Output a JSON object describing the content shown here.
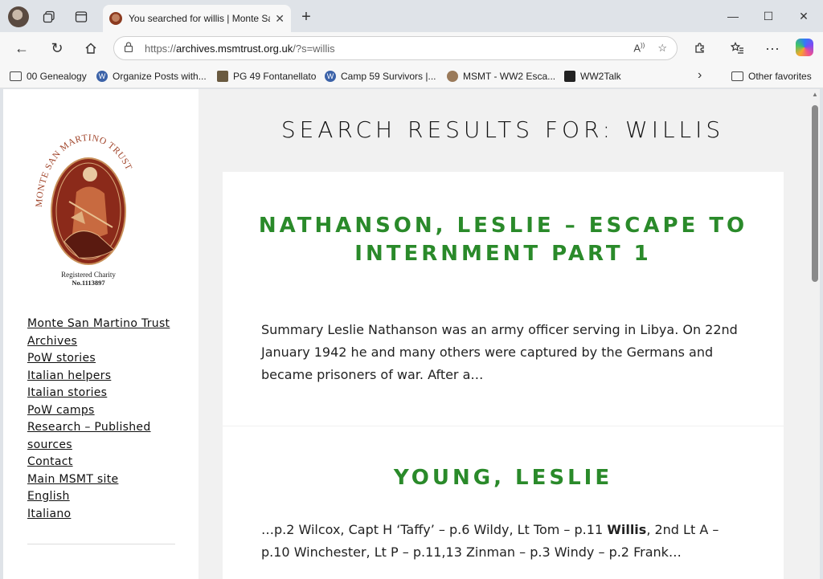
{
  "tab": {
    "title": "You searched for willis | Monte San Martino Trust"
  },
  "window_controls": {
    "minimize": "—",
    "maximize": "☐",
    "close": "✕"
  },
  "address": {
    "url_prefix": "https://",
    "url_host": "archives.msmtrust.org.uk",
    "url_path": "/?s=willis"
  },
  "bookmarks": [
    {
      "label": "00 Genealogy",
      "icon": "folder-icon"
    },
    {
      "label": "Organize Posts with...",
      "icon": "wordpress-icon"
    },
    {
      "label": "PG 49 Fontanellato",
      "icon": "image-icon"
    },
    {
      "label": "Camp 59 Survivors |...",
      "icon": "wordpress-icon"
    },
    {
      "label": "MSMT - WW2 Esca...",
      "icon": "msmt-icon"
    },
    {
      "label": "WW2Talk",
      "icon": "ww2talk-icon"
    }
  ],
  "other_favorites": "Other favorites",
  "sidebar": {
    "logo": {
      "arc_text": "MONTE SAN MARTINO TRUST",
      "line1": "Registered Charity",
      "line2": "No.1113897"
    },
    "nav": [
      "Monte San Martino Trust Archives",
      "PoW stories",
      "Italian helpers",
      "Italian stories",
      "PoW camps",
      "Research – Published sources",
      "Contact",
      "Main MSMT site",
      "English",
      "Italiano"
    ]
  },
  "main": {
    "title": "SEARCH RESULTS FOR: WILLIS",
    "results": [
      {
        "title": "NATHANSON, LESLIE – ESCAPE TO INTERNMENT PART 1",
        "excerpt": "Summary Leslie Nathanson was an army officer serving in Libya. On 22nd January 1942 he and many others were captured by the Germans and became prisoners of war. After a…"
      },
      {
        "title": "YOUNG, LESLIE",
        "excerpt_before": "…p.2 Wilcox, Capt H ‘Taffy’ – p.6 Wildy, Lt Tom – p.11 ",
        "excerpt_highlight": "Willis",
        "excerpt_after": ", 2nd Lt A – p.10 Winchester, Lt P – p.11,13 Zinman – p.3 Windy – p.2 Frank…"
      }
    ]
  },
  "colors": {
    "accent_green": "#2a8a2a",
    "sidebar_bg": "#ffffff",
    "page_bg": "#f1f1f1"
  }
}
